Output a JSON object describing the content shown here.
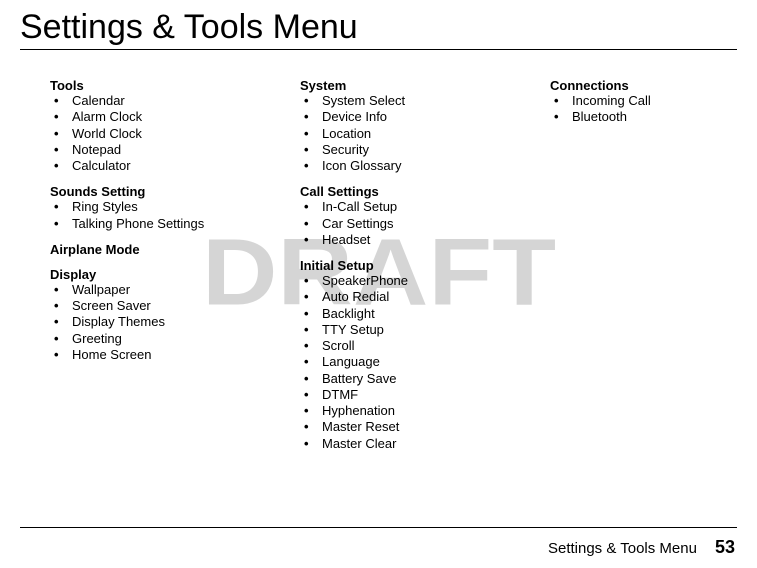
{
  "page": {
    "title": "Settings & Tools Menu",
    "watermark": "DRAFT",
    "footer_title": "Settings & Tools Menu",
    "page_number": "53"
  },
  "col1": {
    "sections": [
      {
        "head": "Tools",
        "items": [
          "Calendar",
          "Alarm Clock",
          "World Clock",
          "Notepad",
          "Calculator"
        ]
      },
      {
        "head": "Sounds Setting",
        "items": [
          "Ring Styles",
          "Talking Phone Settings"
        ]
      },
      {
        "head": "Airplane Mode",
        "items": []
      },
      {
        "head": "Display",
        "items": [
          "Wallpaper",
          "Screen Saver",
          "Display Themes",
          "Greeting",
          "Home Screen"
        ]
      }
    ]
  },
  "col2": {
    "sections": [
      {
        "head": "System",
        "items": [
          "System Select",
          "Device Info",
          "Location",
          "Security",
          "Icon Glossary"
        ]
      },
      {
        "head": "Call Settings",
        "items": [
          "In-Call Setup",
          "Car Settings",
          "Headset"
        ]
      },
      {
        "head": "Initial Setup",
        "items": [
          "SpeakerPhone",
          "Auto Redial",
          "Backlight",
          "TTY Setup",
          "Scroll",
          "Language",
          "Battery Save",
          "DTMF",
          "Hyphenation",
          "Master Reset",
          "Master Clear"
        ]
      }
    ]
  },
  "col3": {
    "sections": [
      {
        "head": "Connections",
        "items": [
          "Incoming Call",
          "Bluetooth"
        ]
      }
    ]
  }
}
